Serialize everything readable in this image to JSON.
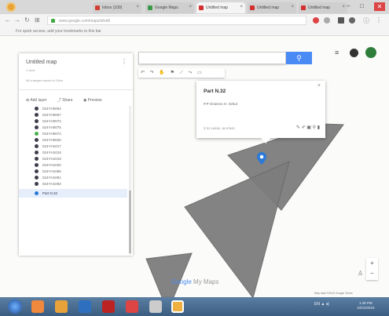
{
  "browser": {
    "tabs": [
      {
        "label": "Inbox (100)",
        "fav_color": "#d23f31",
        "active": false
      },
      {
        "label": "Google Maps",
        "fav_color": "#3a9a4a",
        "active": false
      },
      {
        "label": "Untitled map",
        "fav_color": "#d32f2f",
        "active": true
      },
      {
        "label": "Untitled map",
        "fav_color": "#d32f2f",
        "active": false
      },
      {
        "label": "Untitled map",
        "fav_color": "#d32f2f",
        "active": false
      }
    ],
    "url": "www.google.com/maps/d/edit",
    "bookmarks_hint": "For quick access, add your bookmarks to this bar"
  },
  "panel": {
    "title": "Untitled map",
    "layers_info": "1 view",
    "saved_status": "All changes saved in Drive",
    "actions": {
      "add_layer": "Add layer",
      "share": "Share",
      "preview": "Preview"
    },
    "items": [
      {
        "label": "024YH0064",
        "pin_color": "#3d3d4d"
      },
      {
        "label": "024YH0067",
        "pin_color": "#3d3d4d"
      },
      {
        "label": "024YH0072",
        "pin_color": "#3d3d4d"
      },
      {
        "label": "024YH0075",
        "pin_color": "#3d3d4d"
      },
      {
        "label": "024YH0074",
        "pin_color": "#4caf50"
      },
      {
        "label": "024YH0026",
        "pin_color": "#3d3d4d"
      },
      {
        "label": "024YH1017",
        "pin_color": "#3d3d4d"
      },
      {
        "label": "024YH1018",
        "pin_color": "#3d3d4d"
      },
      {
        "label": "024YH1019",
        "pin_color": "#3d3d4d"
      },
      {
        "label": "024YH1020",
        "pin_color": "#3d3d4d"
      },
      {
        "label": "024YH1086",
        "pin_color": "#3d3d4d"
      },
      {
        "label": "024YH1091",
        "pin_color": "#3d3d4d"
      },
      {
        "label": "024YH1093",
        "pin_color": "#3d3d4d"
      }
    ],
    "selected_item": "Part N.32"
  },
  "popup": {
    "title": "Part N.32",
    "description": "P.P Gniezno H. Szkut",
    "coordinates": "52.16098, 18.57843"
  },
  "map": {
    "watermark_google": "Google",
    "watermark_text": "My Maps",
    "map_data": "Map data ©2016 Google   Terms",
    "polygon_fill": "#7d7d7d"
  },
  "taskbar": {
    "tray": "EN  ▲ ◂)",
    "time": "1:48 PM",
    "date": "10/22/2016"
  }
}
